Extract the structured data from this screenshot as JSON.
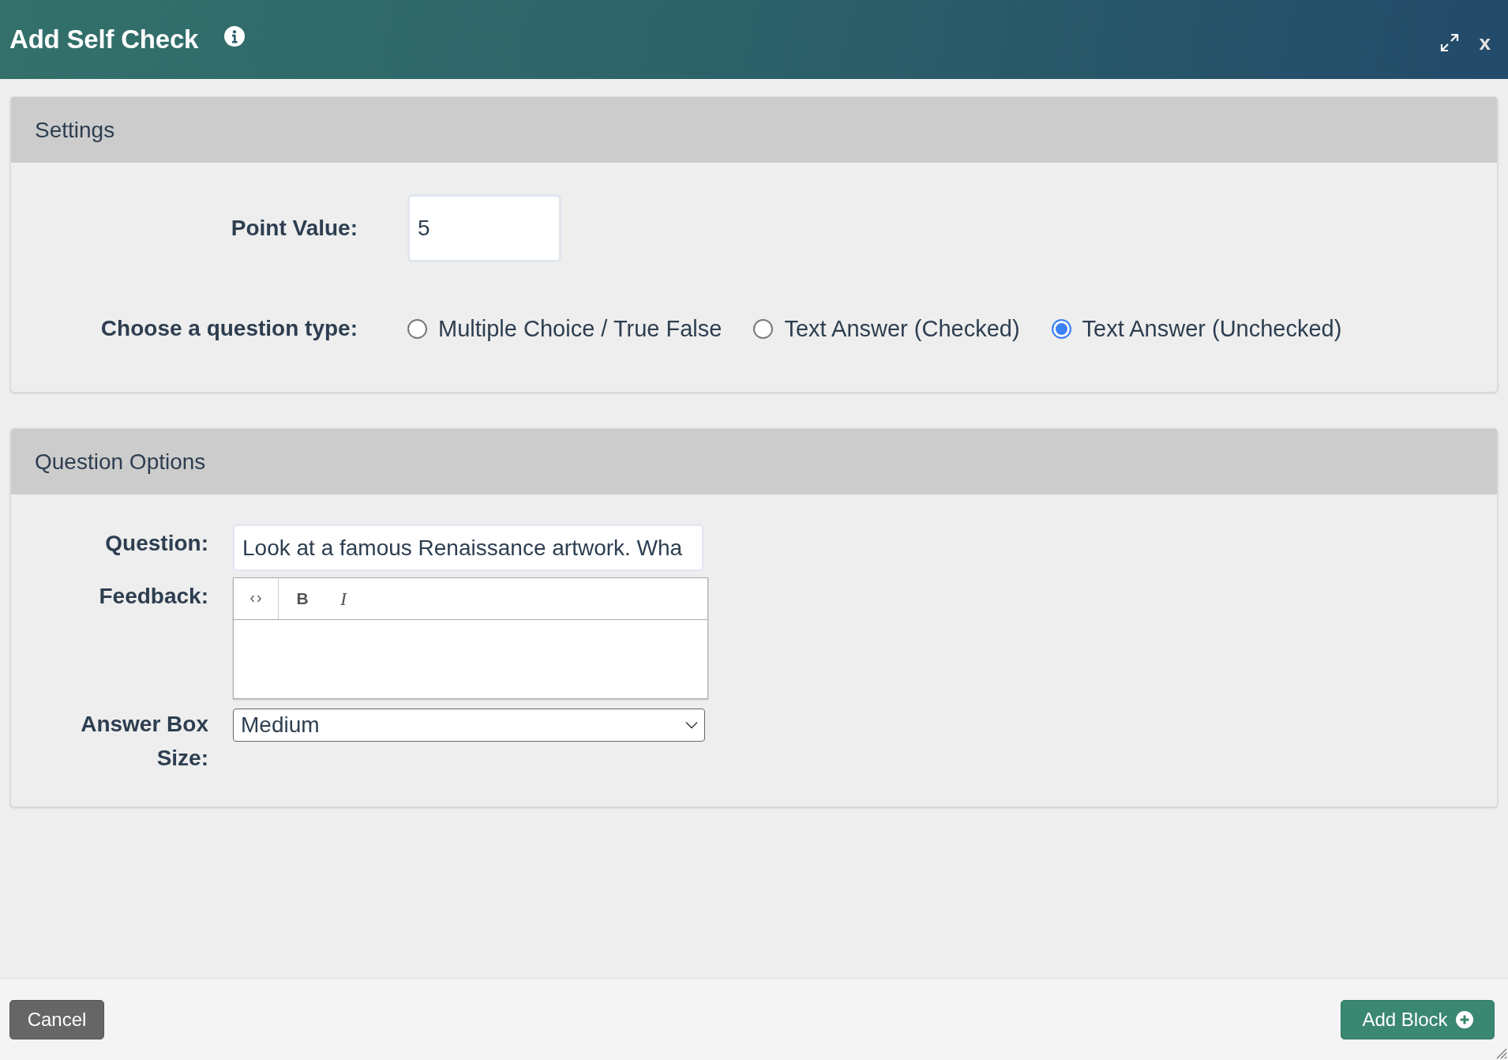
{
  "window": {
    "title": "Add Self Check",
    "close": "x"
  },
  "settings": {
    "title": "Settings",
    "point_value": {
      "label": "Point Value:",
      "value": "5"
    },
    "question_type": {
      "label": "Choose a question type:",
      "options": [
        {
          "label": "Multiple Choice / True False",
          "selected": false
        },
        {
          "label": "Text Answer (Checked)",
          "selected": false
        },
        {
          "label": "Text Answer (Unchecked)",
          "selected": true
        }
      ]
    }
  },
  "question_options": {
    "title": "Question Options",
    "question": {
      "label": "Question:",
      "value": "Look at a famous Renaissance artwork. Wha"
    },
    "feedback": {
      "label": "Feedback:",
      "toolbar": [
        {
          "kind": "source"
        },
        {
          "kind": "bold",
          "label": "B"
        },
        {
          "kind": "italic",
          "label": "I"
        }
      ]
    },
    "answer_box_size": {
      "label": "Answer Box Size:",
      "value": "Medium"
    }
  },
  "footer": {
    "buttons": [
      {
        "label": "Cancel",
        "kind": "cancel"
      },
      {
        "label": "Add Block",
        "kind": "add"
      }
    ]
  }
}
